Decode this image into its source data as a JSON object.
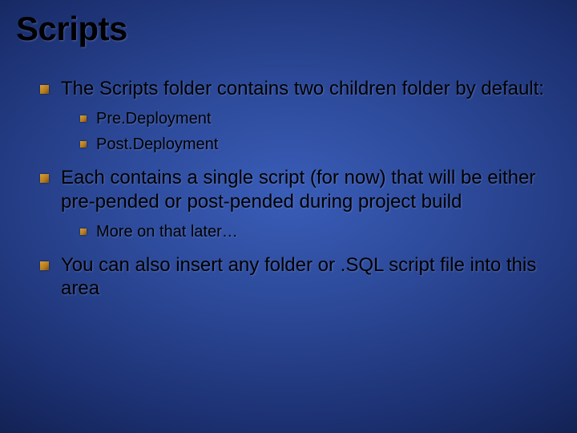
{
  "title": "Scripts",
  "bullets": {
    "b1": "The Scripts folder contains two children folder by default:",
    "b1_sub1": "Pre.Deployment",
    "b1_sub2": "Post.Deployment",
    "b2": "Each contains a single script (for now) that will be either pre-pended or post-pended during project build",
    "b2_sub1": "More on that later…",
    "b3": "You can also insert any folder or .SQL script file into this area"
  }
}
